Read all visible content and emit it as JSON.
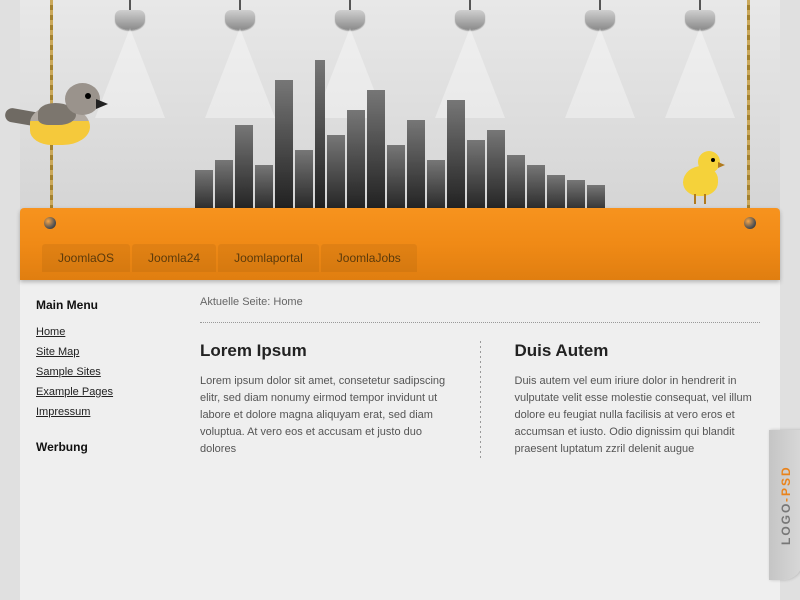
{
  "nav": {
    "tabs": [
      {
        "label": "JoomlaOS"
      },
      {
        "label": "Joomla24"
      },
      {
        "label": "Joomlaportal"
      },
      {
        "label": "JoomlaJobs"
      }
    ]
  },
  "sidebar": {
    "main_menu_title": "Main Menu",
    "items": [
      {
        "label": "Home"
      },
      {
        "label": "Site Map"
      },
      {
        "label": "Sample Sites"
      },
      {
        "label": "Example Pages"
      },
      {
        "label": "Impressum"
      }
    ],
    "ads_title": "Werbung"
  },
  "breadcrumb": {
    "prefix": "Aktuelle Seite: ",
    "current": "Home"
  },
  "columns": {
    "left": {
      "heading": "Lorem Ipsum",
      "body": "Lorem ipsum dolor sit amet, consetetur sadipscing elitr, sed diam nonumy eirmod tempor invidunt ut labore et dolore magna aliquyam erat, sed diam voluptua. At vero eos et accusam et justo duo dolores"
    },
    "right": {
      "heading": "Duis Autem",
      "body": "Duis autem vel eum iriure dolor in hendrerit in vulputate velit esse molestie consequat, vel illum dolore eu feugiat nulla facilisis at vero eros et accumsan et iusto. Odio dignissim qui blandit praesent luptatum zzril delenit augue"
    }
  },
  "sidetab": {
    "part1": "LOGO",
    "sep": " - ",
    "part2": "PSD"
  }
}
